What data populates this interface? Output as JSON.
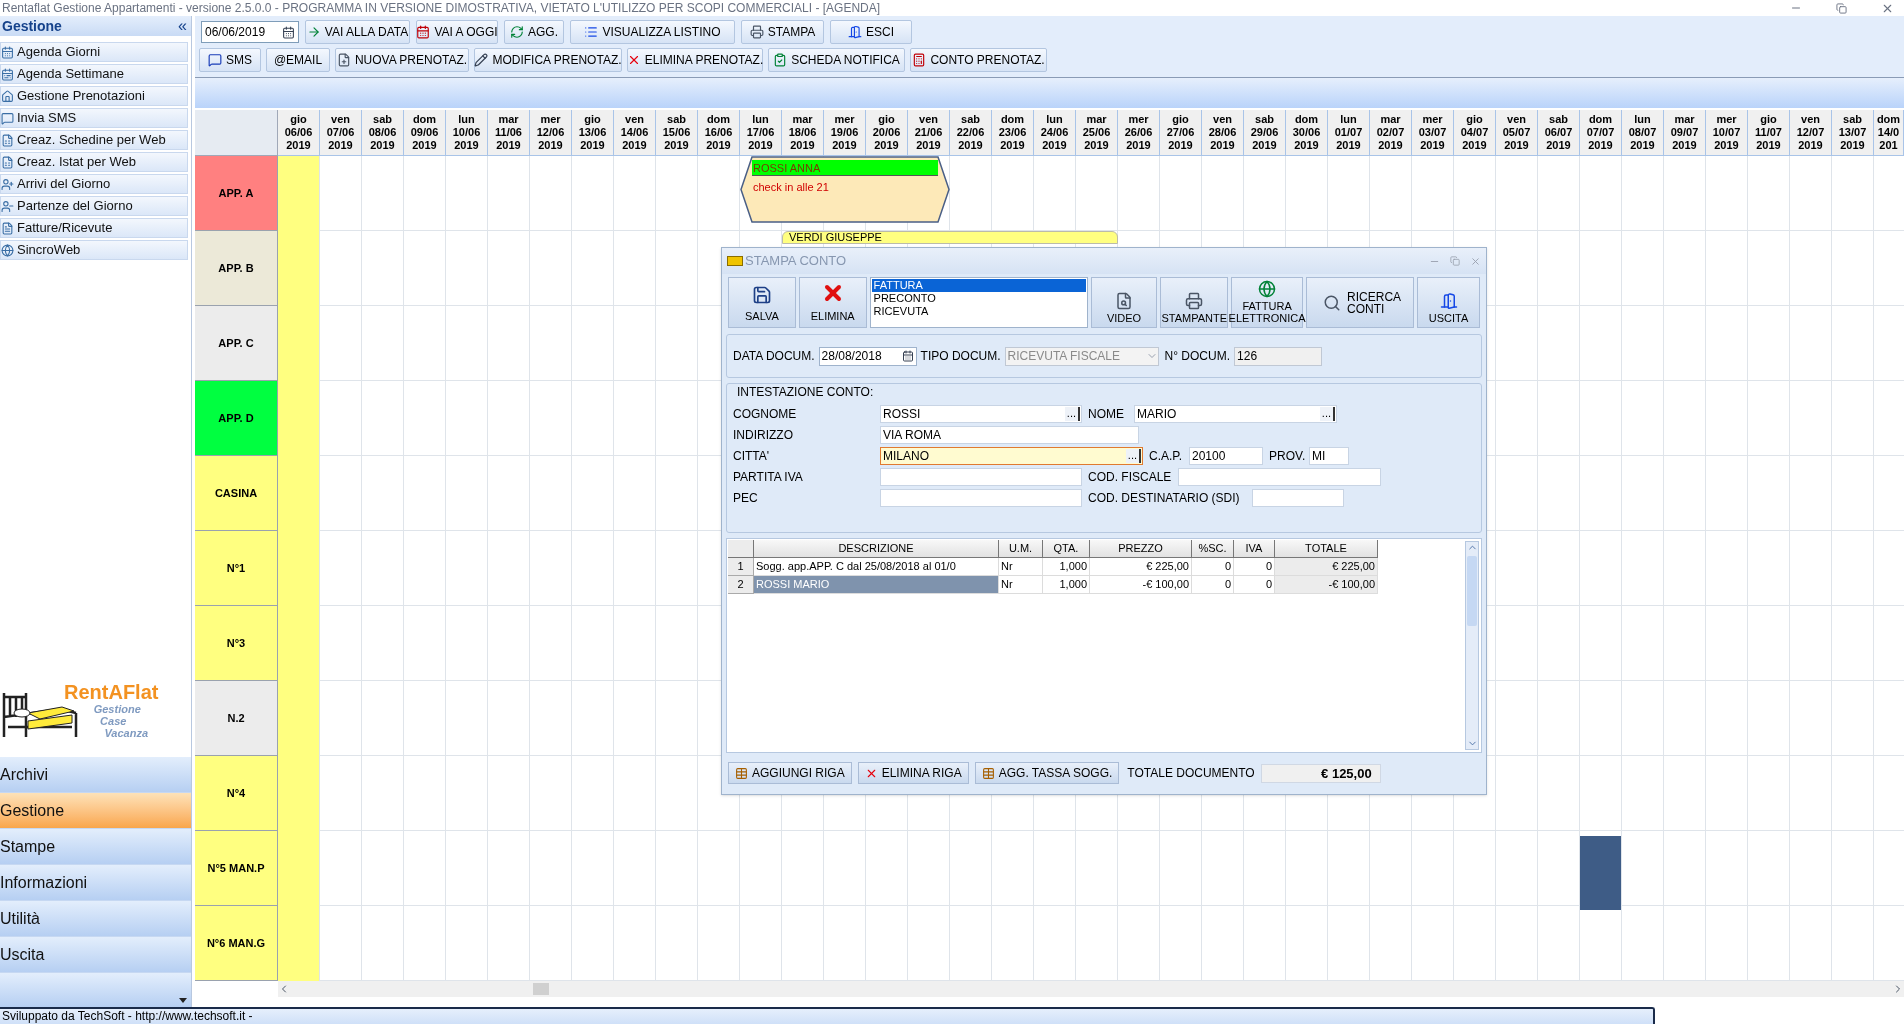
{
  "window": {
    "title": "Rentaflat Gestione Appartamenti - versione 2.5.0.0 - PROGRAMMA IN VERSIONE DIMOSTRATIVA, VIETATO L'UTILIZZO PER SCOPI COMMERCIALI - [AGENDA]"
  },
  "sidebar": {
    "title": "Gestione",
    "collapse": "«",
    "items": [
      {
        "label": "Agenda Giorni"
      },
      {
        "label": "Agenda Settimane"
      },
      {
        "label": "Gestione Prenotazioni"
      },
      {
        "label": "Invia SMS"
      },
      {
        "label": "Creaz. Schedine per Web"
      },
      {
        "label": "Creaz. Istat per Web"
      },
      {
        "label": "Arrivi del Giorno"
      },
      {
        "label": "Partenze del Giorno"
      },
      {
        "label": "Fatture/Ricevute"
      },
      {
        "label": "SincroWeb"
      }
    ],
    "logo": {
      "name": "RentAFlat",
      "tagline": [
        "Gestione",
        "Case",
        "Vacanza"
      ]
    },
    "nav": [
      {
        "label": "Archivi",
        "selected": false
      },
      {
        "label": "Gestione",
        "selected": true
      },
      {
        "label": "Stampe",
        "selected": false
      },
      {
        "label": "Informazioni",
        "selected": false
      },
      {
        "label": "Utilità",
        "selected": false
      },
      {
        "label": "Uscita",
        "selected": false
      }
    ]
  },
  "toolbar": {
    "date": "06/06/2019",
    "row_1": [
      "VAI ALLA DATA",
      "VAI A OGGI",
      "AGG.",
      "VISUALIZZA LISTINO",
      "STAMPA",
      "ESCI"
    ],
    "row_2": [
      "SMS",
      "@EMAIL",
      "NUOVA PRENOTAZ.",
      "MODIFICA PRENOTAZ.",
      "ELIMINA PRENOTAZ.",
      "SCHEDA NOTIFICA",
      "CONTO PRENOTAZ."
    ]
  },
  "days": [
    {
      "dow": "gio",
      "date": "06/06",
      "year": "2019",
      "today": true
    },
    {
      "dow": "ven",
      "date": "07/06",
      "year": "2019",
      "today": false
    },
    {
      "dow": "sab",
      "date": "08/06",
      "year": "2019",
      "today": false
    },
    {
      "dow": "dom",
      "date": "09/06",
      "year": "2019",
      "today": false
    },
    {
      "dow": "lun",
      "date": "10/06",
      "year": "2019",
      "today": false
    },
    {
      "dow": "mar",
      "date": "11/06",
      "year": "2019",
      "today": false
    },
    {
      "dow": "mer",
      "date": "12/06",
      "year": "2019",
      "today": false
    },
    {
      "dow": "gio",
      "date": "13/06",
      "year": "2019",
      "today": false
    },
    {
      "dow": "ven",
      "date": "14/06",
      "year": "2019",
      "today": false
    },
    {
      "dow": "sab",
      "date": "15/06",
      "year": "2019",
      "today": false
    },
    {
      "dow": "dom",
      "date": "16/06",
      "year": "2019",
      "today": false
    },
    {
      "dow": "lun",
      "date": "17/06",
      "year": "2019",
      "today": false
    },
    {
      "dow": "mar",
      "date": "18/06",
      "year": "2019",
      "today": false
    },
    {
      "dow": "mer",
      "date": "19/06",
      "year": "2019",
      "today": false
    },
    {
      "dow": "gio",
      "date": "20/06",
      "year": "2019",
      "today": false
    },
    {
      "dow": "ven",
      "date": "21/06",
      "year": "2019",
      "today": false
    },
    {
      "dow": "sab",
      "date": "22/06",
      "year": "2019",
      "today": false
    },
    {
      "dow": "dom",
      "date": "23/06",
      "year": "2019",
      "today": false
    },
    {
      "dow": "lun",
      "date": "24/06",
      "year": "2019",
      "today": false
    },
    {
      "dow": "mar",
      "date": "25/06",
      "year": "2019",
      "today": false
    },
    {
      "dow": "mer",
      "date": "26/06",
      "year": "2019",
      "today": false
    },
    {
      "dow": "gio",
      "date": "27/06",
      "year": "2019",
      "today": false
    },
    {
      "dow": "ven",
      "date": "28/06",
      "year": "2019",
      "today": false
    },
    {
      "dow": "sab",
      "date": "29/06",
      "year": "2019",
      "today": false
    },
    {
      "dow": "dom",
      "date": "30/06",
      "year": "2019",
      "today": false
    },
    {
      "dow": "lun",
      "date": "01/07",
      "year": "2019",
      "today": false
    },
    {
      "dow": "mar",
      "date": "02/07",
      "year": "2019",
      "today": false
    },
    {
      "dow": "mer",
      "date": "03/07",
      "year": "2019",
      "today": false
    },
    {
      "dow": "gio",
      "date": "04/07",
      "year": "2019",
      "today": false
    },
    {
      "dow": "ven",
      "date": "05/07",
      "year": "2019",
      "today": false
    },
    {
      "dow": "sab",
      "date": "06/07",
      "year": "2019",
      "today": false
    },
    {
      "dow": "dom",
      "date": "07/07",
      "year": "2019",
      "today": false
    },
    {
      "dow": "lun",
      "date": "08/07",
      "year": "2019",
      "today": false
    },
    {
      "dow": "mar",
      "date": "09/07",
      "year": "2019",
      "today": false
    },
    {
      "dow": "mer",
      "date": "10/07",
      "year": "2019",
      "today": false
    },
    {
      "dow": "gio",
      "date": "11/07",
      "year": "2019",
      "today": false
    },
    {
      "dow": "ven",
      "date": "12/07",
      "year": "2019",
      "today": false
    },
    {
      "dow": "sab",
      "date": "13/07",
      "year": "2019",
      "today": false
    },
    {
      "dow": "dom",
      "date": "14/0",
      "year": "201",
      "today": false
    }
  ],
  "rooms": [
    {
      "name": "APP. A",
      "color": "#ff8080"
    },
    {
      "name": "APP. B",
      "color": "#ece9d8"
    },
    {
      "name": "APP. C",
      "color": "#ececec"
    },
    {
      "name": "APP. D",
      "color": "#00ff40"
    },
    {
      "name": "CASINA",
      "color": "#ffff80"
    },
    {
      "name": "N°1",
      "color": "#ffff80"
    },
    {
      "name": "N°3",
      "color": "#ffff80"
    },
    {
      "name": "N.2",
      "color": "#ececec"
    },
    {
      "name": "N°4",
      "color": "#ffff80"
    },
    {
      "name": "N°5 MAN.P",
      "color": "#ffff80"
    },
    {
      "name": "N°6 MAN.G",
      "color": "#ffff80"
    }
  ],
  "bookings": [
    {
      "kind": "hexagon",
      "name": "ROSSI ANNA",
      "note": "check in alle 21",
      "color": "#00ff00"
    },
    {
      "kind": "bar",
      "name": "VERDI GIUSEPPE",
      "color": "#ffff80"
    },
    {
      "kind": "block",
      "color": "#3e5c86"
    }
  ],
  "dialog": {
    "title": "STAMPA CONTO",
    "buttons_left": [
      "SALVA",
      "ELIMINA"
    ],
    "doc_types": [
      {
        "label": "FATTURA",
        "selected": true
      },
      {
        "label": "PRECONTO",
        "selected": false
      },
      {
        "label": "RICEVUTA",
        "selected": false
      }
    ],
    "buttons_right": [
      "VIDEO",
      "STAMPANTE",
      "FATTURA ELETTRONICA",
      "RICERCA CONTI",
      "USCITA"
    ],
    "doc_row": {
      "date_label": "DATA DOCUM.",
      "date": "28/08/2018",
      "type_label": "TIPO DOCUM.",
      "type": "RICEVUTA FISCALE",
      "number_label": "N° DOCUM.",
      "number": "126"
    },
    "group_title": "INTESTAZIONE CONTO:",
    "field_rows": [
      [
        {
          "label": "COGNOME",
          "value": "ROSSI",
          "button": "...",
          "focused": false
        },
        {
          "label": "NOME",
          "value": "MARIO",
          "button": "...",
          "focused": false
        }
      ],
      [
        {
          "label": "INDIRIZZO",
          "value": "VIA ROMA",
          "focused": false
        }
      ],
      [
        {
          "label": "CITTA'",
          "value": "MILANO",
          "button": "...",
          "focused": true
        },
        {
          "label": "C.A.P.",
          "value": "20100",
          "focused": false
        },
        {
          "label": "PROV.",
          "value": "MI",
          "focused": false
        }
      ],
      [
        {
          "label": "PARTITA IVA",
          "focused": false
        },
        {
          "label": "COD. FISCALE",
          "focused": false
        }
      ],
      [
        {
          "label": "PEC",
          "focused": false
        },
        {
          "label": "COD. DESTINATARIO (SDI)",
          "focused": false
        }
      ]
    ],
    "table": {
      "columns": [
        "DESCRIZIONE",
        "U.M.",
        "QTA.",
        "PREZZO",
        "%SC.",
        "IVA",
        "TOTALE"
      ],
      "rows": [
        {
          "number": "1",
          "cells": [
            "Sogg. app.APP. C dal 25/08/2018 al 01/0",
            "Nr",
            "1,000",
            "€ 225,00",
            "0",
            "0",
            "€ 225,00"
          ],
          "selected": false
        },
        {
          "number": "2",
          "cells": [
            "ROSSI MARIO",
            "Nr",
            "1,000",
            "-€ 100,00",
            "0",
            "0",
            "-€ 100,00"
          ],
          "selected": true
        }
      ]
    },
    "bottom_buttons": [
      "AGGIUNGI RIGA",
      "ELIMINA RIGA",
      "AGG. TASSA SOGG."
    ],
    "total_label": "TOTALE DOCUMENTO",
    "total": "€ 125,00"
  },
  "status_bar": "Sviluppato da TechSoft - http://www.techsoft.it -"
}
